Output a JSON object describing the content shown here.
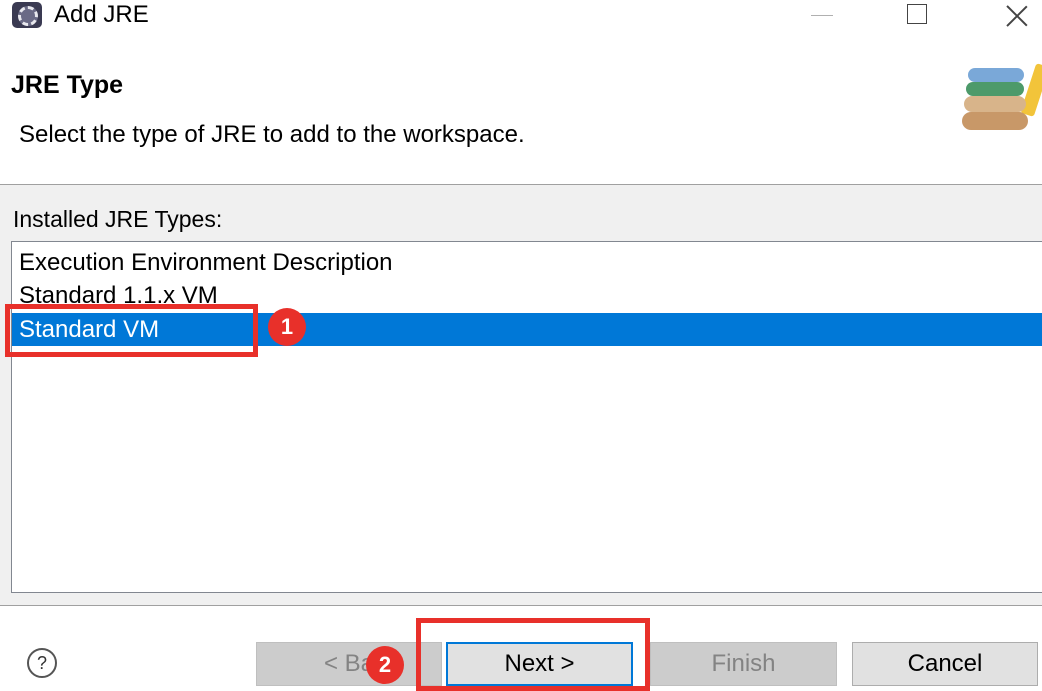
{
  "window": {
    "title": "Add JRE"
  },
  "page": {
    "heading": "JRE Type",
    "description": "Select the type of JRE to add to the workspace."
  },
  "list": {
    "label": "Installed JRE Types:",
    "items": [
      "Execution Environment Description",
      "Standard 1.1.x VM",
      "Standard VM"
    ],
    "selected_index": 2
  },
  "buttons": {
    "help": "?",
    "back": "< Ba",
    "next": "Next >",
    "finish": "Finish",
    "cancel": "Cancel"
  },
  "annotations": {
    "badge1": "1",
    "badge2": "2"
  },
  "colors": {
    "selection": "#0078d7",
    "annotation": "#e8302a",
    "dialog_bg": "#f0f0f0"
  }
}
